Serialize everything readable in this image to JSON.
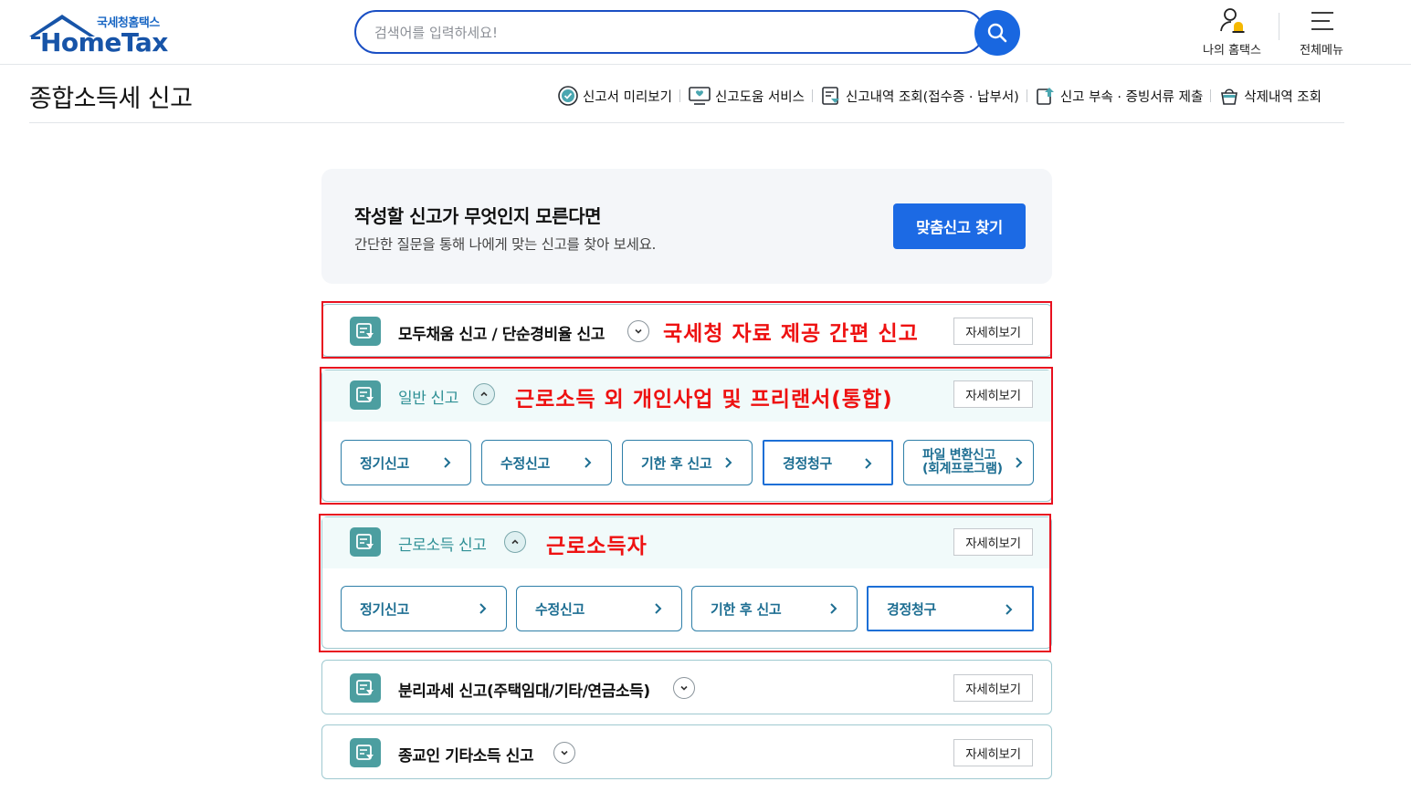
{
  "header": {
    "logo_kor": "국세청홈택스",
    "logo_eng": "HomeTax",
    "search_placeholder": "검색어를 입력하세요!",
    "my_hometax": "나의 홈택스",
    "all_menu": "전체메뉴"
  },
  "page": {
    "title": "종합소득세 신고",
    "quicklinks": [
      {
        "label": "신고서 미리보기",
        "icon": "check-circle-icon"
      },
      {
        "label": "신고도움 서비스",
        "icon": "monitor-help-icon"
      },
      {
        "label": "신고내역 조회(접수증 · 납부서)",
        "icon": "document-search-icon"
      },
      {
        "label": "신고 부속 · 증빙서류 제출",
        "icon": "document-upload-icon"
      },
      {
        "label": "삭제내역 조회",
        "icon": "trash-basket-icon"
      }
    ]
  },
  "guide": {
    "title": "작성할 신고가 무엇인지 모른다면",
    "subtitle": "간단한 질문을 통해 나에게 맞는 신고를 찾아 보세요.",
    "button": "맞춤신고 찾기"
  },
  "detail_label": "자세히보기",
  "cards": [
    {
      "title": "모두채움 신고 / 단순경비율 신고",
      "expanded": false,
      "annotation": "국세청 자료 제공 간편 신고"
    },
    {
      "title": "일반 신고",
      "expanded": true,
      "annotation": "근로소득 외 개인사업 및 프리랜서(통합)",
      "buttons": [
        "정기신고",
        "수정신고",
        "기한 후 신고",
        "경정청구",
        "파일 변환신고",
        "(회계프로그램)"
      ]
    },
    {
      "title": "근로소득 신고",
      "expanded": true,
      "annotation": "근로소득자",
      "buttons": [
        "정기신고",
        "수정신고",
        "기한 후 신고",
        "경정청구"
      ]
    },
    {
      "title": "분리과세 신고(주택임대/기타/연금소득)",
      "expanded": false
    },
    {
      "title": "종교인 기타소득 신고",
      "expanded": false
    }
  ],
  "colors": {
    "brand_blue": "#1c6ae4",
    "teal": "#4c9ea0",
    "annotation_red": "#e8101f"
  }
}
